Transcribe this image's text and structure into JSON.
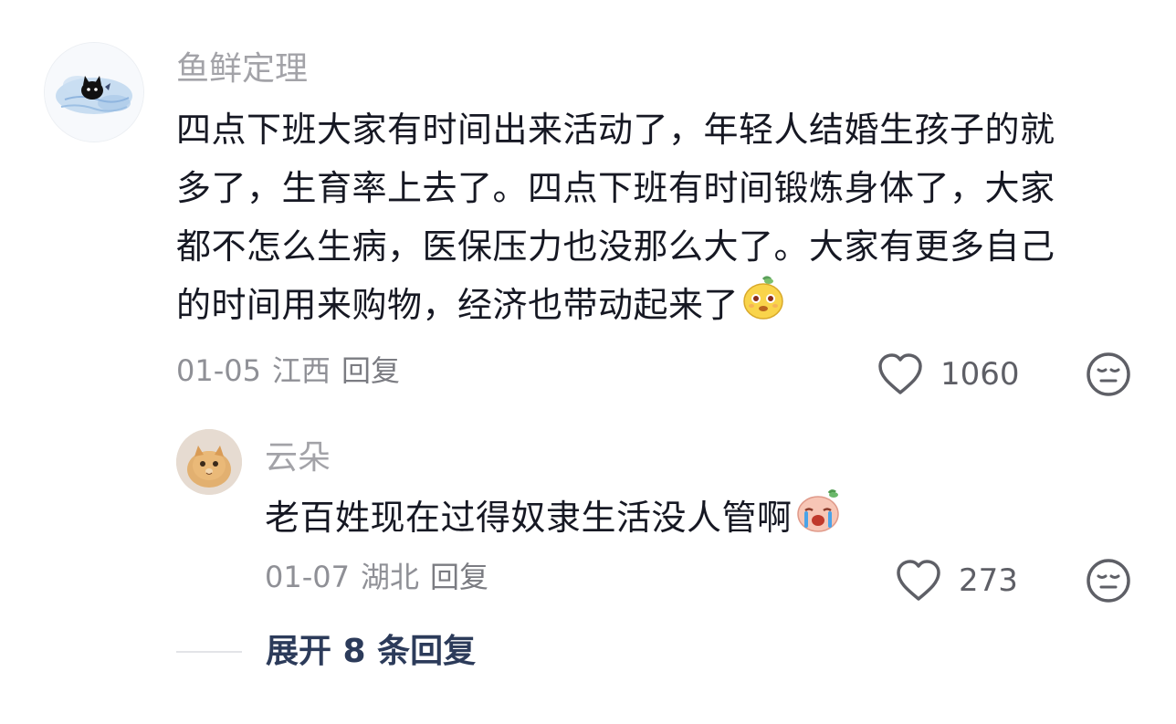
{
  "comment": {
    "username": "鱼鲜定理",
    "text_lines": [
      "四点下班大家有时间出来活动了，年轻人结婚生孩子的就",
      "多了，生育率上去了。四点下班有时间锻炼身体了，大家",
      "都不怎么生病，医保压力也没那么大了。大家有更多自己",
      "的时间用来购物，经济也带动起来了"
    ],
    "emoji": "yellow-smile-emoji",
    "date": "01-05",
    "location": "江西",
    "reply_label": "回复",
    "like_count": "1060",
    "avatar_icon": "black-cat-avatar"
  },
  "reply": {
    "username": "云朵",
    "text": "老百姓现在过得奴隶生活没人管啊",
    "emoji": "crying-emoji",
    "date": "01-07",
    "location": "湖北",
    "reply_label": "回复",
    "like_count": "273",
    "avatar_icon": "cat-photo-avatar"
  },
  "expand": {
    "label": "展开 8 条回复"
  },
  "colors": {
    "text": "#161823",
    "muted": "#a3a3a8",
    "meta": "#8f9096",
    "link": "#2c3b5a"
  }
}
